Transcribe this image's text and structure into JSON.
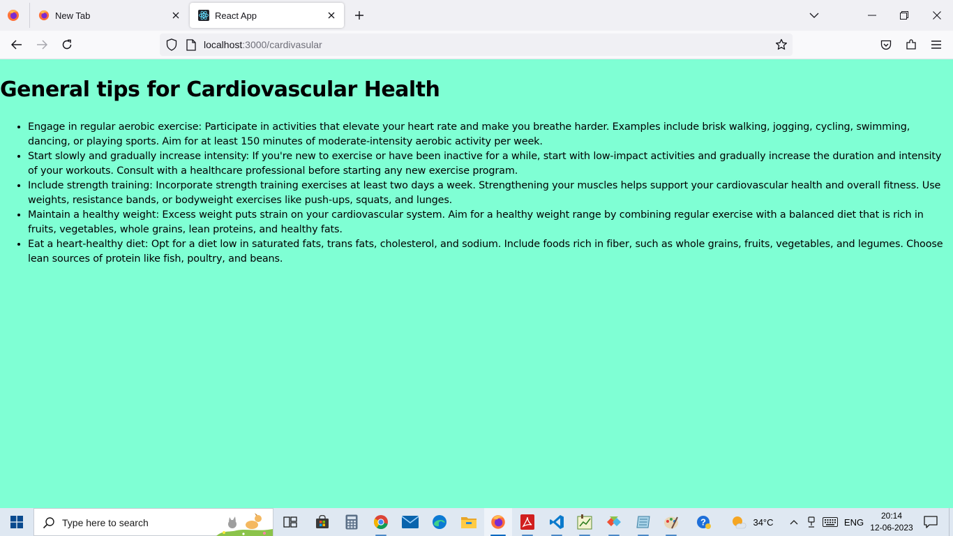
{
  "browser": {
    "tabs": [
      {
        "label": "New Tab",
        "icon": "firefox-icon",
        "active": false
      },
      {
        "label": "React App",
        "icon": "react-icon",
        "active": true
      }
    ],
    "url": {
      "host": "localhost",
      "path": ":3000/cardivasular"
    }
  },
  "page": {
    "heading": "General tips for Cardiovascular Health",
    "tips": [
      "Engage in regular aerobic exercise: Participate in activities that elevate your heart rate and make you breathe harder. Examples include brisk walking, jogging, cycling, swimming, dancing, or playing sports. Aim for at least 150 minutes of moderate-intensity aerobic activity per week.",
      "Start slowly and gradually increase intensity: If you're new to exercise or have been inactive for a while, start with low-impact activities and gradually increase the duration and intensity of your workouts. Consult with a healthcare professional before starting any new exercise program.",
      "Include strength training: Incorporate strength training exercises at least two days a week. Strengthening your muscles helps support your cardiovascular health and overall fitness. Use weights, resistance bands, or bodyweight exercises like push-ups, squats, and lunges.",
      "Maintain a healthy weight: Excess weight puts strain on your cardiovascular system. Aim for a healthy weight range by combining regular exercise with a balanced diet that is rich in fruits, vegetables, whole grains, lean proteins, and healthy fats.",
      "Eat a heart-healthy diet: Opt for a diet low in saturated fats, trans fats, cholesterol, and sodium. Include foods rich in fiber, such as whole grains, fruits, vegetables, and legumes. Choose lean sources of protein like fish, poultry, and beans."
    ],
    "background": "#7fffd4"
  },
  "taskbar": {
    "search_placeholder": "Type here to search",
    "apps": [
      "task-view-icon",
      "store-icon",
      "calculator-icon",
      "chrome-icon",
      "mail-icon",
      "edge-icon",
      "file-explorer-icon",
      "firefox-icon",
      "acrobat-icon",
      "vscode-icon",
      "chart-app-icon",
      "git-icon",
      "notepad-icon",
      "paint-icon"
    ],
    "weather": {
      "temp": "34°C"
    },
    "language": "ENG",
    "time": "20:14",
    "date": "12-06-2023"
  }
}
